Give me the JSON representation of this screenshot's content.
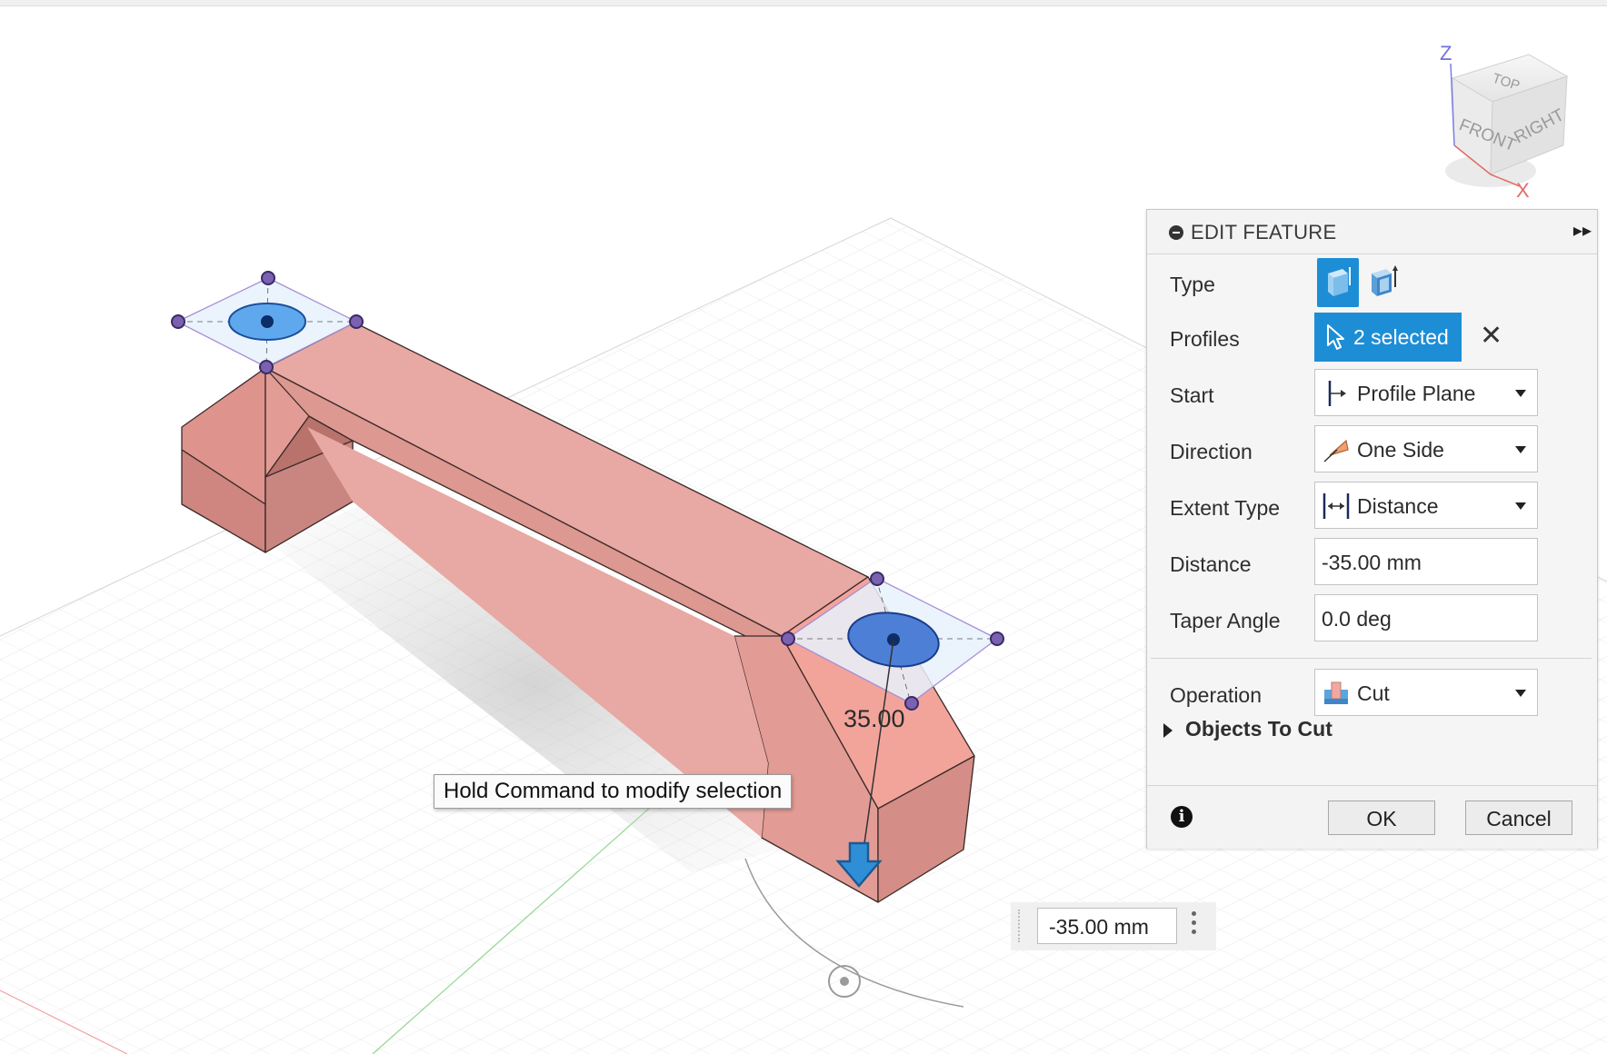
{
  "viewport": {
    "dimension_value": "35.00",
    "tooltip": "Hold Command to modify selection",
    "floating_input_value": "-35.00 mm",
    "model_color": "#e8a19b"
  },
  "view_cube": {
    "top": "TOP",
    "front": "FRONT",
    "right": "RIGHT",
    "axis_z": "Z",
    "axis_x": "X"
  },
  "panel": {
    "title": "EDIT FEATURE",
    "rows": {
      "type": {
        "label": "Type"
      },
      "profiles": {
        "label": "Profiles",
        "value": "2 selected"
      },
      "start": {
        "label": "Start",
        "value": "Profile Plane"
      },
      "direction": {
        "label": "Direction",
        "value": "One Side"
      },
      "extent_type": {
        "label": "Extent Type",
        "value": "Distance"
      },
      "distance": {
        "label": "Distance",
        "value": "-35.00 mm"
      },
      "taper_angle": {
        "label": "Taper Angle",
        "value": "0.0 deg"
      },
      "operation": {
        "label": "Operation",
        "value": "Cut"
      }
    },
    "objects_to_cut": "Objects To Cut",
    "ok_label": "OK",
    "cancel_label": "Cancel",
    "accent_color": "#1d8ed6"
  }
}
